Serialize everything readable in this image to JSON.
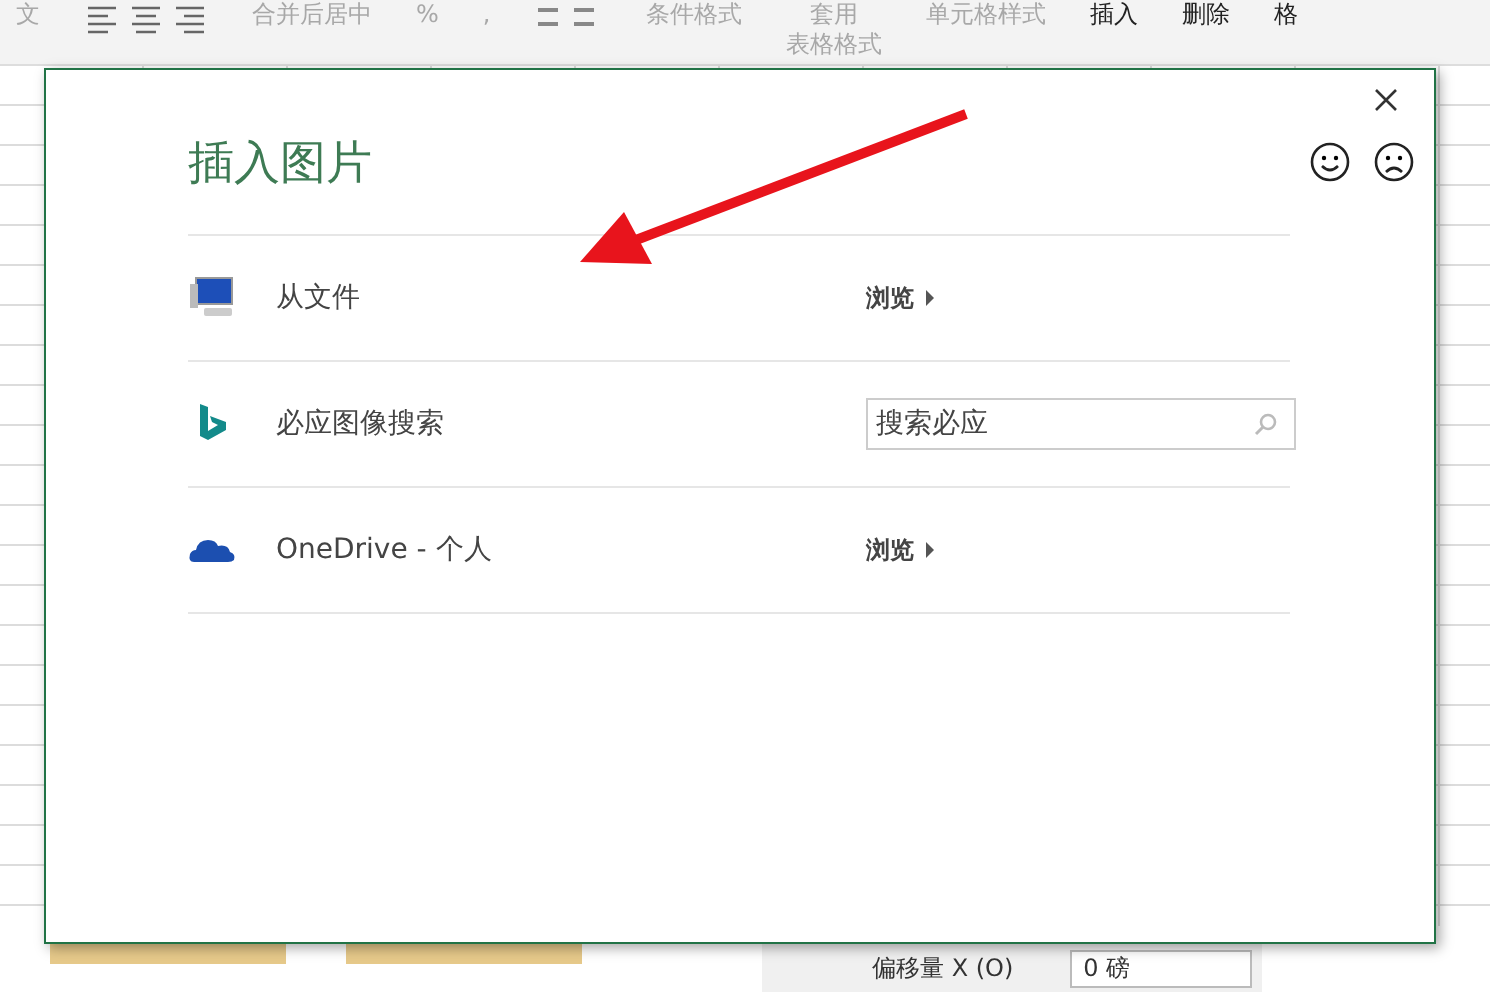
{
  "ribbon": {
    "items": [
      {
        "kind": "text",
        "label": "文"
      },
      {
        "kind": "align"
      },
      {
        "kind": "text",
        "label": "合并后居中"
      },
      {
        "kind": "text",
        "label": "%"
      },
      {
        "kind": "text",
        "label": ","
      },
      {
        "kind": "decimal"
      },
      {
        "kind": "text",
        "label": "条件格式"
      },
      {
        "kind": "stack",
        "label": "套用",
        "sub": "表格格式"
      },
      {
        "kind": "text",
        "label": "单元格样式"
      },
      {
        "kind": "bold",
        "label": "插入"
      },
      {
        "kind": "bold",
        "label": "删除"
      },
      {
        "kind": "bold",
        "label": "格"
      }
    ]
  },
  "dialog": {
    "title": "插入图片",
    "sources": [
      {
        "kind": "browse",
        "label": "从文件",
        "action": "浏览"
      },
      {
        "kind": "search",
        "label": "必应图像搜索",
        "placeholder": "搜索必应"
      },
      {
        "kind": "browse",
        "label": "OneDrive - 个人",
        "action": "浏览"
      }
    ]
  },
  "format_pane": {
    "label": "偏移量 X (O)",
    "value": "0 磅"
  }
}
